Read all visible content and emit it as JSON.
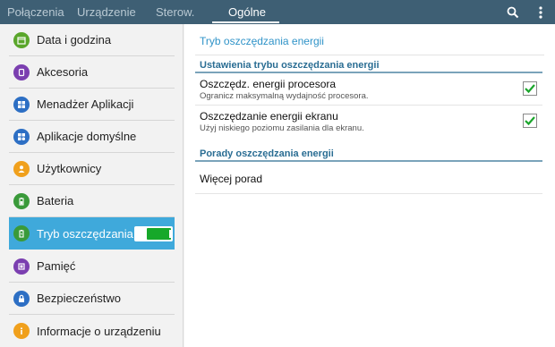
{
  "tabs": [
    {
      "label": "Połączenia",
      "active": false
    },
    {
      "label": "Urządzenie",
      "active": false
    },
    {
      "label": "Sterow.",
      "active": false
    },
    {
      "label": "Ogólne",
      "active": true
    }
  ],
  "toolbar_icons": [
    "search-icon",
    "more-vert-icon"
  ],
  "sidebar": {
    "items": [
      {
        "label": "Data i godzina",
        "icon": "calendar-icon",
        "color": "#5aa62b"
      },
      {
        "label": "Akcesoria",
        "icon": "accessory-icon",
        "color": "#7b3fb0"
      },
      {
        "label": "Menadżer Aplikacji",
        "icon": "app-grid-icon",
        "color": "#2d6fc4"
      },
      {
        "label": "Aplikacje domyślne",
        "icon": "apps-default-icon",
        "color": "#2d6fc4"
      },
      {
        "label": "Użytkownicy",
        "icon": "users-icon",
        "color": "#f0a01c"
      },
      {
        "label": "Bateria",
        "icon": "battery-icon",
        "color": "#3a9a3a"
      },
      {
        "label": "Tryb oszczędzania",
        "icon": "power-saving-icon",
        "color": "#3a9a3a",
        "selected": true,
        "toggle": true
      },
      {
        "label": "Pamięć",
        "icon": "storage-icon",
        "color": "#7b3fb0"
      },
      {
        "label": "Bezpieczeństwo",
        "icon": "lock-icon",
        "color": "#2d6fc4"
      },
      {
        "label": "Informacje o urządzeniu",
        "icon": "info-icon",
        "color": "#f0a01c"
      }
    ]
  },
  "main": {
    "title": "Tryb oszczędzania energii",
    "section1": {
      "header": "Ustawienia trybu oszczędzania energii",
      "rows": [
        {
          "title": "Oszczędz. energii procesora",
          "subtitle": "Ogranicz maksymalną wydajność procesora.",
          "checked": true
        },
        {
          "title": "Oszczędzanie energii ekranu",
          "subtitle": "Użyj niskiego poziomu zasilania dla ekranu.",
          "checked": true
        }
      ]
    },
    "section2": {
      "header": "Porady oszczędzania energii",
      "link": "Więcej porad"
    }
  },
  "colors": {
    "topbar": "#3e5f74",
    "accent": "#3fa9db",
    "check": "#1aa52b",
    "toggle_on": "#16a82a"
  }
}
